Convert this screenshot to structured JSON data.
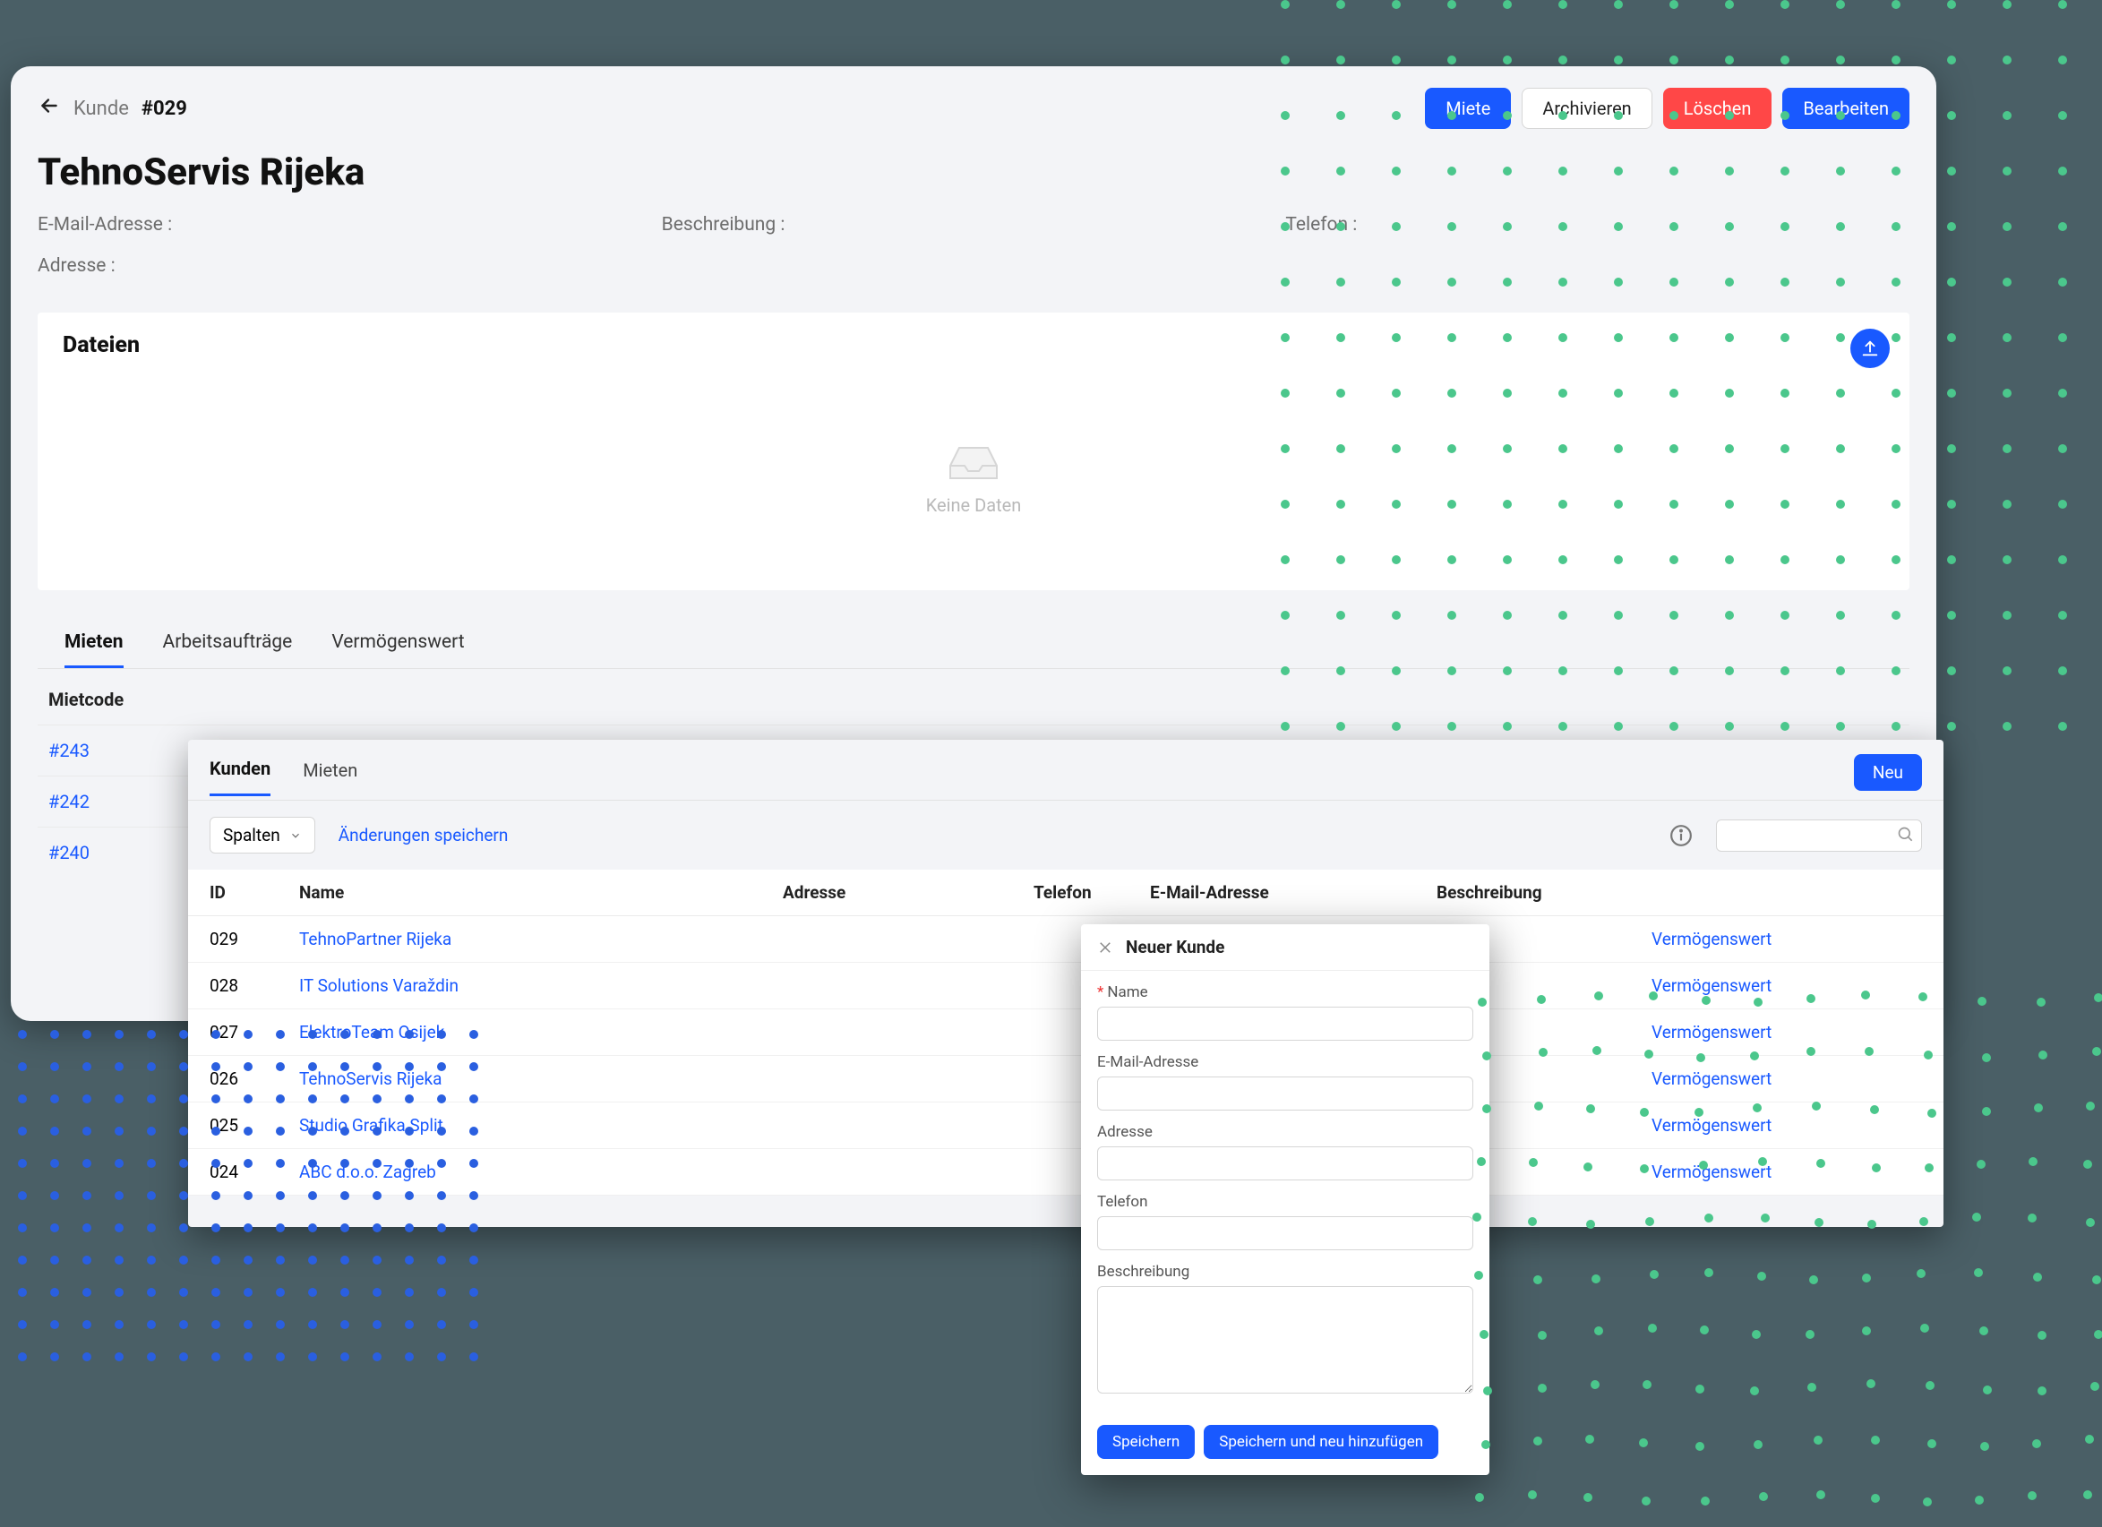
{
  "breadcrumb": {
    "label": "Kunde",
    "id": "#029"
  },
  "title": "TehnoServis Rijeka",
  "actions": {
    "rent": "Miete",
    "archive": "Archivieren",
    "delete": "Löschen",
    "edit": "Bearbeiten"
  },
  "detail_labels": {
    "email": "E-Mail-Adresse :",
    "desc": "Beschreibung :",
    "phone": "Telefon :",
    "address": "Adresse :"
  },
  "files": {
    "heading": "Dateien",
    "empty": "Keine Daten"
  },
  "detail_tabs": {
    "rent": "Mieten",
    "work": "Arbeitsaufträge",
    "asset": "Vermögenswert"
  },
  "rent_table": {
    "col_code": "Mietcode",
    "rows": [
      "#243",
      "#242",
      "#240"
    ]
  },
  "list": {
    "tabs": {
      "customers": "Kunden",
      "rentals": "Mieten"
    },
    "new_btn": "Neu",
    "columns_btn": "Spalten",
    "save_changes": "Änderungen speichern",
    "headers": {
      "id": "ID",
      "name": "Name",
      "address": "Adresse",
      "phone": "Telefon",
      "email": "E-Mail-Adresse",
      "desc": "Beschreibung"
    },
    "asset_link": "Vermögenswert",
    "rows": [
      {
        "id": "029",
        "name": "TehnoPartner Rijeka"
      },
      {
        "id": "028",
        "name": "IT Solutions Varaždin"
      },
      {
        "id": "027",
        "name": "ElektroTeam Osijek"
      },
      {
        "id": "026",
        "name": "TehnoServis Rijeka"
      },
      {
        "id": "025",
        "name": "Studio Grafika Split"
      },
      {
        "id": "024",
        "name": "ABC d.o.o. Zagreb"
      }
    ]
  },
  "modal": {
    "title": "Neuer Kunde",
    "fields": {
      "name": "Name",
      "email": "E-Mail-Adresse",
      "address": "Adresse",
      "phone": "Telefon",
      "desc": "Beschreibung"
    },
    "save": "Speichern",
    "save_new": "Speichern und neu hinzufügen"
  }
}
